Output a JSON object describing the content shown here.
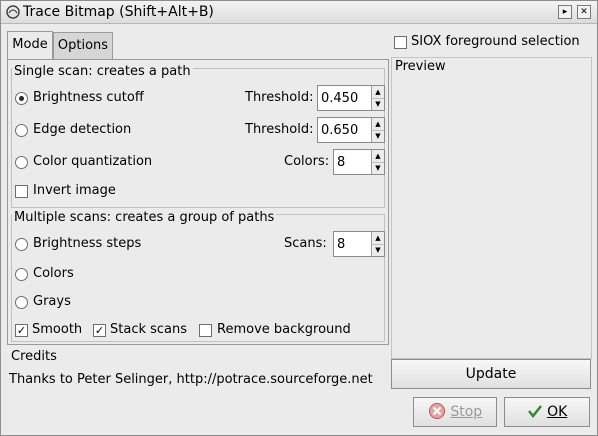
{
  "window": {
    "title": "Trace Bitmap (Shift+Alt+B)",
    "titlebar_buttons": [
      "minimize-icon",
      "close-icon"
    ]
  },
  "tabs": [
    {
      "label": "Mode",
      "active": true
    },
    {
      "label": "Options",
      "active": false
    }
  ],
  "single_scan": {
    "label": "Single scan: creates a path",
    "options": [
      {
        "label": "Brightness cutoff",
        "checked": true,
        "param_label": "Threshold:",
        "param_value": "0.450"
      },
      {
        "label": "Edge detection",
        "checked": false,
        "param_label": "Threshold:",
        "param_value": "0.650"
      },
      {
        "label": "Color quantization",
        "checked": false,
        "param_label": "Colors:",
        "param_value": "8"
      }
    ],
    "invert": {
      "label": "Invert image",
      "checked": false
    }
  },
  "multiple_scans": {
    "label": "Multiple scans: creates a group of paths",
    "options": [
      {
        "label": "Brightness steps",
        "checked": false,
        "param_label": "Scans:",
        "param_value": "8"
      },
      {
        "label": "Colors",
        "checked": false
      },
      {
        "label": "Grays",
        "checked": false
      }
    ],
    "checkboxes": [
      {
        "label": "Smooth",
        "checked": true
      },
      {
        "label": "Stack scans",
        "checked": true
      },
      {
        "label": "Remove background",
        "checked": false
      }
    ]
  },
  "siox": {
    "label": "SIOX foreground selection",
    "checked": false
  },
  "preview": {
    "label": "Preview"
  },
  "credits": {
    "label": "Credits",
    "text": "Thanks to Peter Selinger, http://potrace.sourceforge.net"
  },
  "buttons": {
    "update": "Update",
    "stop": "Stop",
    "ok": "OK"
  },
  "colors": {
    "background": "#ebebeb",
    "stop_icon": "#c85050",
    "ok_icon": "#2f8a2f"
  }
}
